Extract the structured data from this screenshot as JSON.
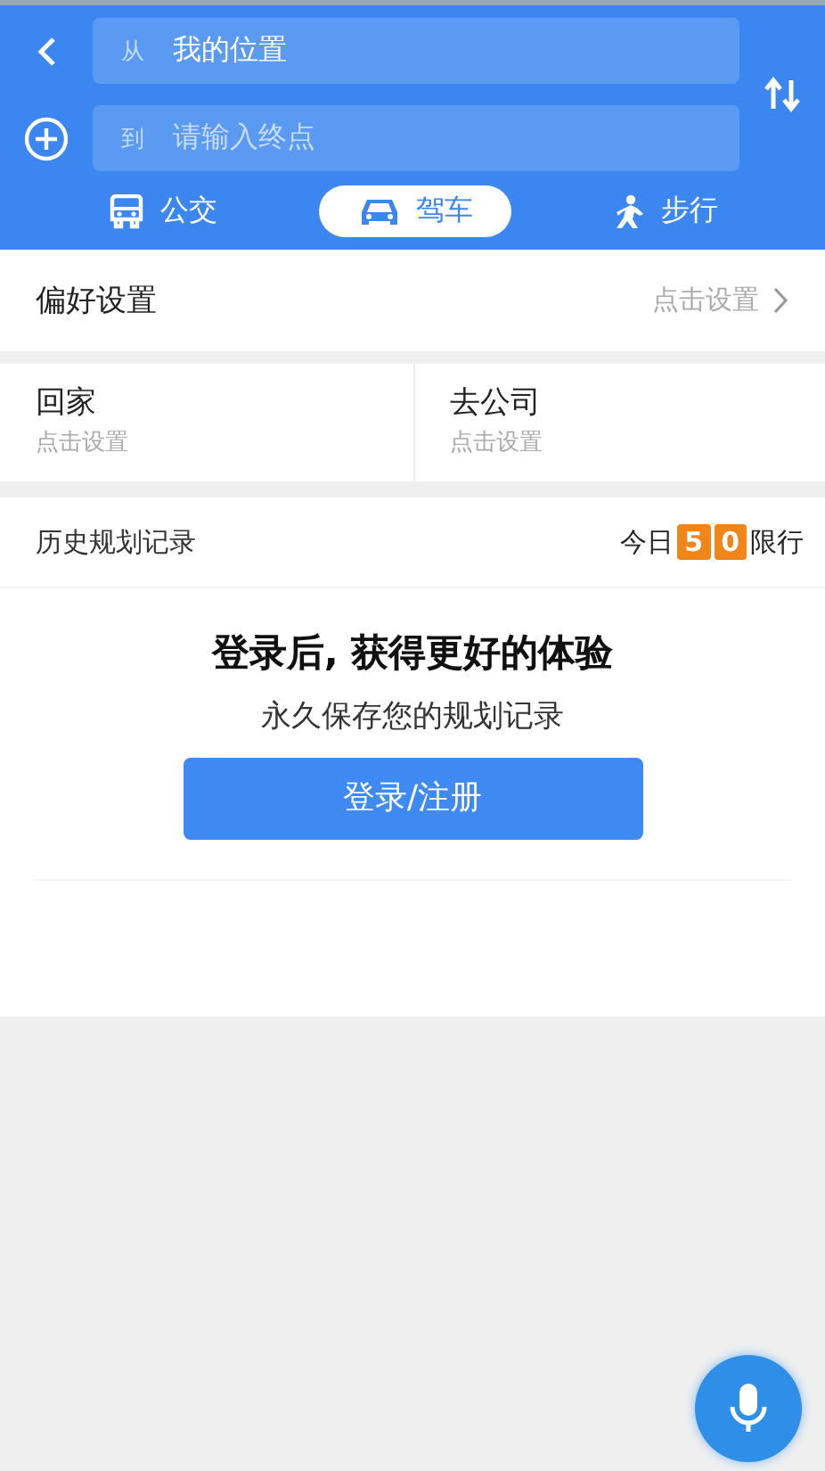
{
  "route": {
    "from": {
      "prefix": "从",
      "value": "我的位置"
    },
    "to": {
      "prefix": "到",
      "placeholder": "请输入终点"
    }
  },
  "modes": [
    {
      "kind": "bus",
      "label": "公交",
      "selected": false
    },
    {
      "kind": "car",
      "label": "驾车",
      "selected": true
    },
    {
      "kind": "walk",
      "label": "步行",
      "selected": false
    }
  ],
  "preferences": {
    "title": "偏好设置",
    "action": "点击设置"
  },
  "shortcuts": [
    {
      "title": "回家",
      "subtitle": "点击设置"
    },
    {
      "title": "去公司",
      "subtitle": "点击设置"
    }
  ],
  "history": {
    "title": "历史规划记录",
    "restriction": {
      "prefix": "今日",
      "digits": [
        "5",
        "0"
      ],
      "suffix": "限行"
    }
  },
  "login_prompt": {
    "heading": "登录后, 获得更好的体验",
    "text": "永久保存您的规划记录",
    "button": "登录/注册"
  }
}
